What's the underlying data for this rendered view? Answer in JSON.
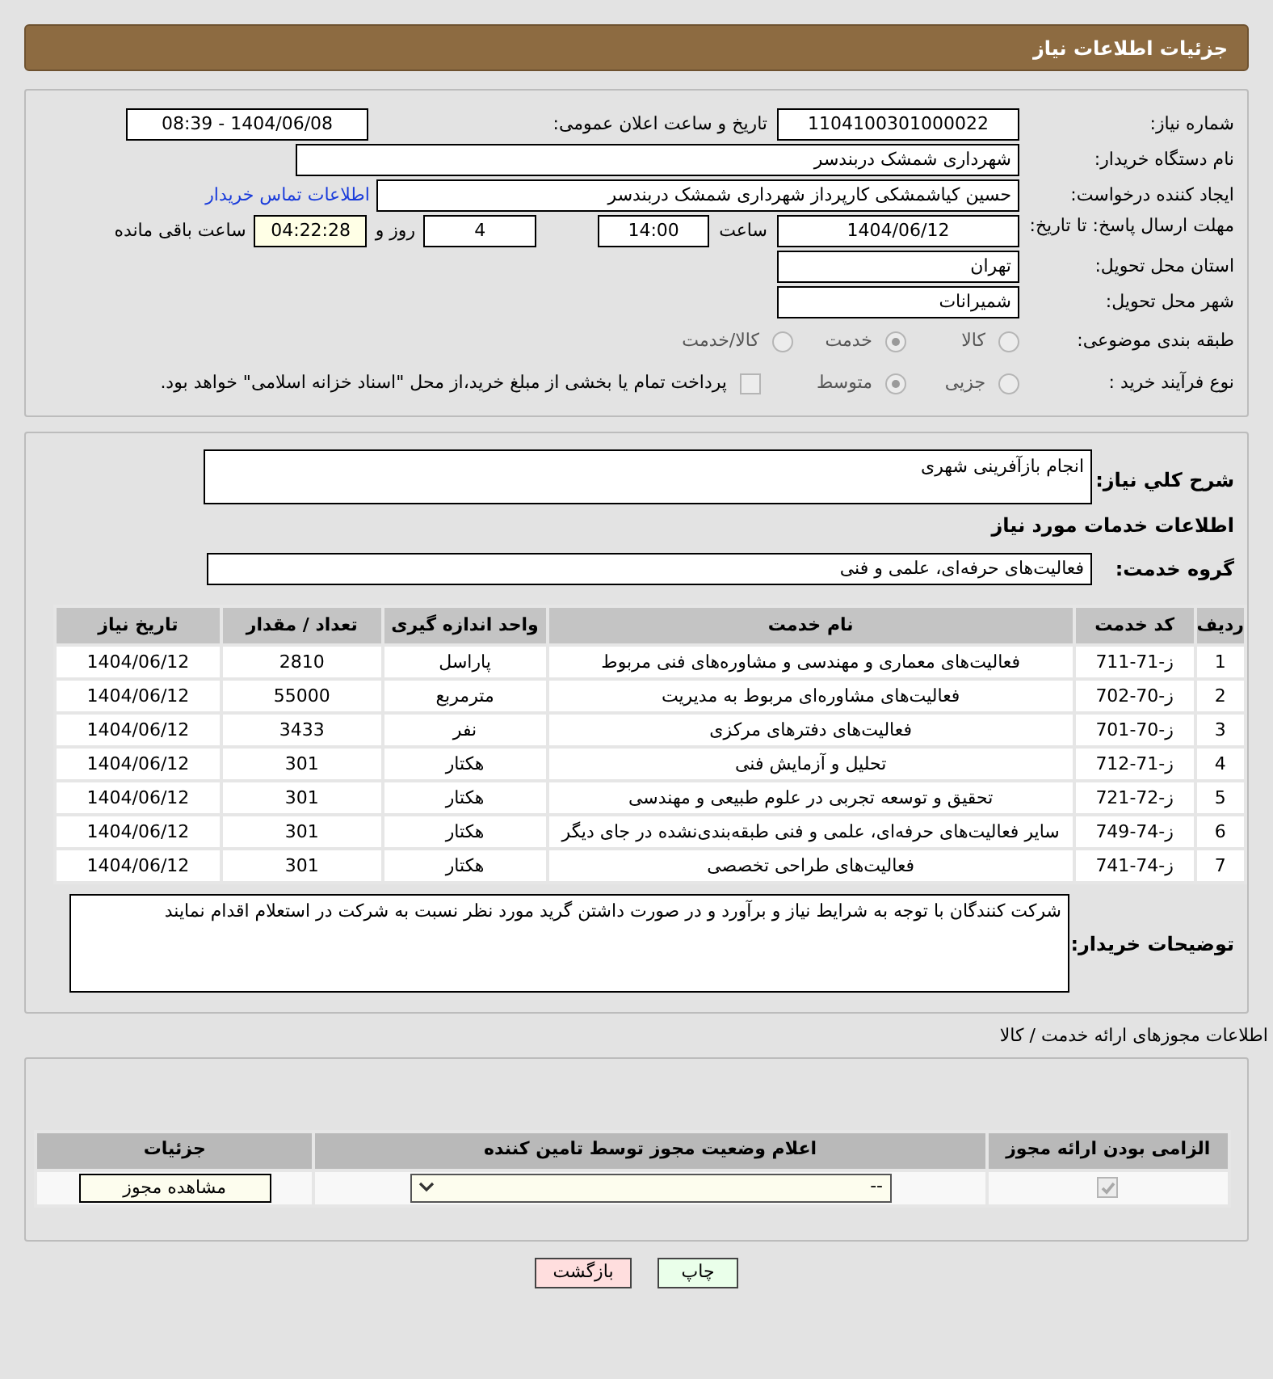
{
  "header": {
    "title": "جزئیات اطلاعات نیاز"
  },
  "details": {
    "need_number": {
      "label": "شماره نیاز:",
      "value": "1104100301000022"
    },
    "announce_datetime": {
      "label": "تاریخ و ساعت اعلان عمومی:",
      "value": "1404/06/08 - 08:39"
    },
    "buyer_org": {
      "label": "نام دستگاه خریدار:",
      "value": "شهرداری شمشک دربندسر"
    },
    "requester": {
      "label": "ایجاد کننده درخواست:",
      "value": "حسین کیاشمشکی کارپرداز شهرداری شمشک دربندسر",
      "link": "اطلاعات تماس خریدار"
    },
    "deadline": {
      "label": "مهلت ارسال پاسخ: تا تاریخ:",
      "date": "1404/06/12",
      "time_label": "ساعت",
      "time": "14:00",
      "days": "4",
      "days_label": "روز و",
      "remaining": "04:22:28",
      "remaining_label": "ساعت باقی مانده"
    },
    "province": {
      "label": "استان محل تحویل:",
      "value": "تهران"
    },
    "city": {
      "label": "شهر محل تحویل:",
      "value": "شمیرانات"
    },
    "category": {
      "label": "طبقه بندی موضوعی:",
      "options": [
        {
          "label": "کالا",
          "selected": false
        },
        {
          "label": "خدمت",
          "selected": true
        },
        {
          "label": "کالا/خدمت",
          "selected": false
        }
      ]
    },
    "process": {
      "label": "نوع فرآیند خرید :",
      "options": [
        {
          "label": "جزیی",
          "selected": false
        },
        {
          "label": "متوسط",
          "selected": true
        }
      ],
      "treasury": {
        "label": "پرداخت تمام یا بخشی از مبلغ خرید،از محل \"اسناد خزانه اسلامی\" خواهد بود.",
        "checked": false
      }
    }
  },
  "description": {
    "label": "شرح کلي نياز:",
    "value": "انجام بازآفرینی شهری"
  },
  "services_title": "اطلاعات خدمات مورد نیاز",
  "service_group": {
    "label": "گروه خدمت:",
    "value": "فعالیت‌های حرفه‌ای، علمی و فنی"
  },
  "services_table": {
    "columns": [
      "ردیف",
      "کد خدمت",
      "نام خدمت",
      "واحد اندازه گیری",
      "تعداد / مقدار",
      "تاریخ نیاز"
    ],
    "rows": [
      [
        "1",
        "ز-71-711",
        "فعالیت‌های معماری و مهندسی و مشاوره‌های فنی مربوط",
        "پاراسل",
        "2810",
        "1404/06/12"
      ],
      [
        "2",
        "ز-70-702",
        "فعالیت‌های مشاوره‌ای مربوط به مدیریت",
        "مترمربع",
        "55000",
        "1404/06/12"
      ],
      [
        "3",
        "ز-70-701",
        "فعالیت‌های دفترهای مرکزی",
        "نفر",
        "3433",
        "1404/06/12"
      ],
      [
        "4",
        "ز-71-712",
        "تحلیل و آزمایش فنی",
        "هکتار",
        "301",
        "1404/06/12"
      ],
      [
        "5",
        "ز-72-721",
        "تحقیق و توسعه تجربی در علوم طبیعی و مهندسی",
        "هکتار",
        "301",
        "1404/06/12"
      ],
      [
        "6",
        "ز-74-749",
        "سایر فعالیت‌های حرفه‌ای، علمی و فنی طبقه‌بندی‌نشده در جای دیگر",
        "هکتار",
        "301",
        "1404/06/12"
      ],
      [
        "7",
        "ز-74-741",
        "فعالیت‌های طراحی تخصصی",
        "هکتار",
        "301",
        "1404/06/12"
      ]
    ]
  },
  "buyer_notes": {
    "label": "توضیحات خریدار:",
    "value": "شرکت کنندگان با توجه به شرایط نیاز و برآورد و در صورت داشتن گرید مورد نظر نسبت به شرکت در استعلام اقدام نمایند"
  },
  "permits_title": "اطلاعات مجوزهای ارائه خدمت / کالا",
  "permits_table": {
    "columns": [
      "الزامی بودن ارائه مجوز",
      "اعلام وضعیت مجوز توسط تامین کننده",
      "جزئیات"
    ],
    "rows": [
      {
        "required": true,
        "status": "--",
        "details_button": "مشاهده مجوز"
      }
    ]
  },
  "buttons": [
    {
      "label": "چاپ",
      "kind": "print"
    },
    {
      "label": "بازگشت",
      "kind": "back"
    }
  ]
}
